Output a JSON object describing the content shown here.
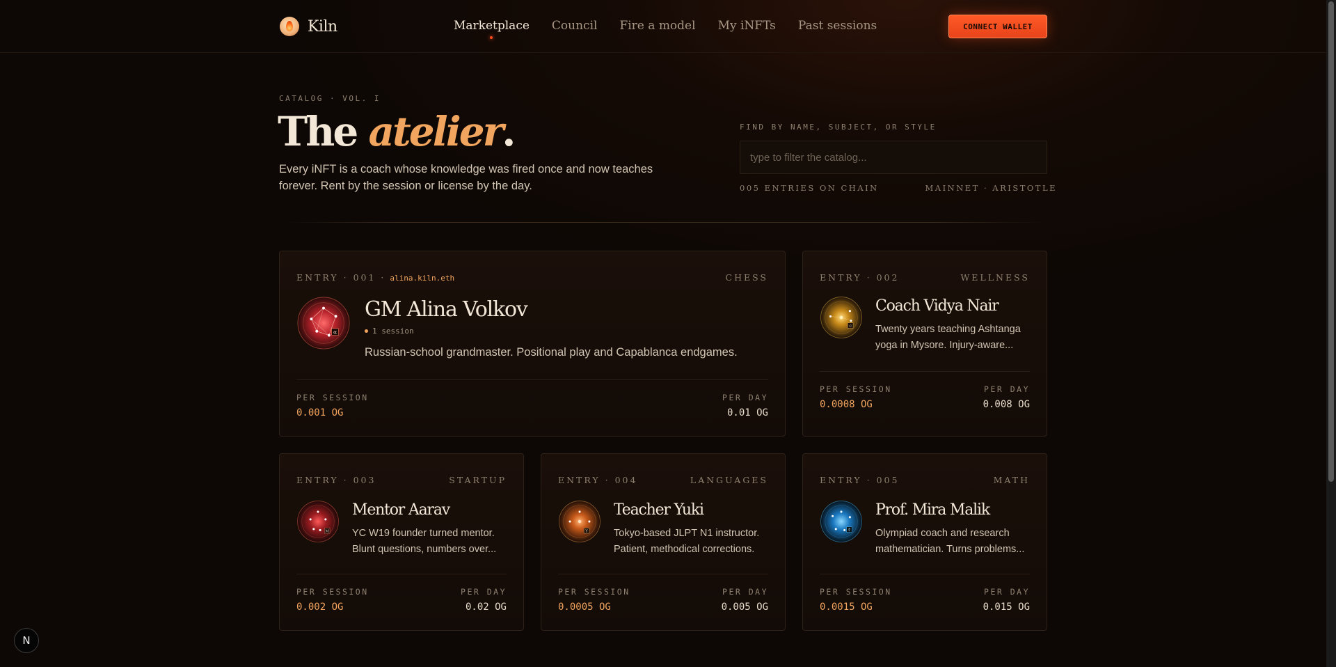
{
  "header": {
    "brand_name": "Kiln",
    "nav": [
      {
        "label": "Marketplace",
        "active": true
      },
      {
        "label": "Council"
      },
      {
        "label": "Fire a model"
      },
      {
        "label": "My iNFTs"
      },
      {
        "label": "Past sessions"
      }
    ],
    "connect_label": "CONNECT WALLET"
  },
  "hero": {
    "eyebrow": "CATALOG · VOL. I",
    "title_prefix": "The ",
    "title_emphasis": "atelier",
    "title_suffix": ".",
    "description": "Every iNFT is a coach whose knowledge was fired once and now teaches forever. Rent by the session or license by the day."
  },
  "search": {
    "label": "FIND BY NAME, SUBJECT, OR STYLE",
    "placeholder": "type to filter the catalog...",
    "value": "",
    "entries_count": "005 ENTRIES ON CHAIN",
    "network": "MAINNET · ARISTOTLE"
  },
  "price_labels": {
    "per_session": "PER SESSION",
    "per_day": "PER DAY"
  },
  "cards": [
    {
      "entry": "ENTRY · 001 ·",
      "ens": "alina.kiln.eth",
      "category": "CHESS",
      "name": "GM Alina Volkov",
      "sessions": "1 session",
      "description": "Russian-school grandmaster. Positional play and Capablanca endgames.",
      "per_session": "0.001 OG",
      "per_day": "0.01 OG",
      "glyph": "α",
      "color": "#e0363a"
    },
    {
      "entry": "ENTRY · 002",
      "category": "WELLNESS",
      "name": "Coach Vidya Nair",
      "description": "Twenty years teaching Ashtanga yoga in Mysore. Injury-aware...",
      "per_session": "0.0008 OG",
      "per_day": "0.008 OG",
      "glyph": "c",
      "color": "#f0a624"
    },
    {
      "entry": "ENTRY · 003",
      "category": "STARTUP",
      "name": "Mentor Aarav",
      "description": "YC W19 founder turned mentor. Blunt questions, numbers over...",
      "per_session": "0.002 OG",
      "per_day": "0.02 OG",
      "glyph": "M",
      "color": "#e03a36"
    },
    {
      "entry": "ENTRY · 004",
      "category": "LANGUAGES",
      "name": "Teacher Yuki",
      "description": "Tokyo-based JLPT N1 instructor. Patient, methodical corrections.",
      "per_session": "0.0005 OG",
      "per_day": "0.005 OG",
      "glyph": "Y",
      "color": "#f07a24"
    },
    {
      "entry": "ENTRY · 005",
      "category": "MATH",
      "name": "Prof. Mira Malik",
      "description": "Olympiad coach and research mathematician. Turns problems...",
      "per_session": "0.0015 OG",
      "per_day": "0.015 OG",
      "glyph": "∜",
      "color": "#2ea8f0"
    }
  ],
  "dev_badge": "N"
}
